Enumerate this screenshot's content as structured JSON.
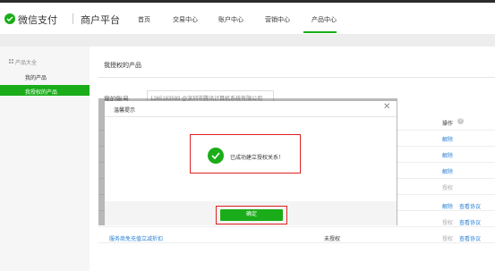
{
  "header": {
    "brand": "微信支付",
    "brand_sub": "商户平台",
    "nav": [
      "首页",
      "交易中心",
      "账户中心",
      "营销中心",
      "产品中心"
    ],
    "nav_active": "产品中心"
  },
  "sidebar": {
    "heading": "产品大全",
    "items": [
      "我的产品",
      "我授权的产品"
    ],
    "active": "我授权的产品"
  },
  "main": {
    "title": "我授权的产品",
    "account_label": "我的账号",
    "account_value": "1265183593 @深圳市腾讯计算机系统有限公司",
    "column_operation": "操作",
    "rows": [
      {
        "actions": [
          "解除"
        ]
      },
      {
        "actions": [
          "解除"
        ]
      },
      {
        "actions": [
          "解除"
        ]
      },
      {
        "actions": [
          "授权"
        ],
        "disabled": true
      },
      {
        "actions": [
          "解除",
          "查看协议"
        ]
      },
      {
        "actions": [
          "授权",
          "查看协议"
        ],
        "disabled": true
      }
    ],
    "last_row": {
      "product": "服务商免充值立减折扣",
      "status": "未授权",
      "actions": [
        "授权",
        "查看协议"
      ]
    }
  },
  "modal": {
    "title": "温馨提示",
    "message": "已成功建立授权关系！",
    "confirm": "确定"
  },
  "colors": {
    "accent": "#1aad19",
    "link": "#2a7fd4",
    "highlight": "#e02020"
  }
}
